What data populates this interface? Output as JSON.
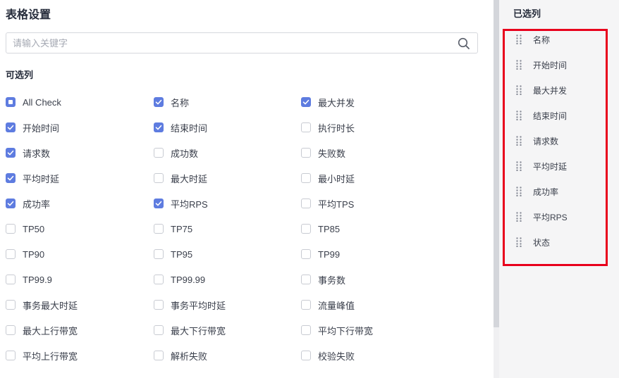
{
  "panel": {
    "title": "表格设置"
  },
  "search": {
    "placeholder": "请输入关键字"
  },
  "available": {
    "title": "可选列",
    "options": [
      {
        "label": "All Check",
        "state": "indeterminate"
      },
      {
        "label": "名称",
        "state": "checked"
      },
      {
        "label": "最大并发",
        "state": "checked"
      },
      {
        "label": "开始时间",
        "state": "checked"
      },
      {
        "label": "结束时间",
        "state": "checked"
      },
      {
        "label": "执行时长",
        "state": "unchecked"
      },
      {
        "label": "请求数",
        "state": "checked"
      },
      {
        "label": "成功数",
        "state": "unchecked"
      },
      {
        "label": "失败数",
        "state": "unchecked"
      },
      {
        "label": "平均时延",
        "state": "checked"
      },
      {
        "label": "最大时延",
        "state": "unchecked"
      },
      {
        "label": "最小时延",
        "state": "unchecked"
      },
      {
        "label": "成功率",
        "state": "checked"
      },
      {
        "label": "平均RPS",
        "state": "checked"
      },
      {
        "label": "平均TPS",
        "state": "unchecked"
      },
      {
        "label": "TP50",
        "state": "unchecked"
      },
      {
        "label": "TP75",
        "state": "unchecked"
      },
      {
        "label": "TP85",
        "state": "unchecked"
      },
      {
        "label": "TP90",
        "state": "unchecked"
      },
      {
        "label": "TP95",
        "state": "unchecked"
      },
      {
        "label": "TP99",
        "state": "unchecked"
      },
      {
        "label": "TP99.9",
        "state": "unchecked"
      },
      {
        "label": "TP99.99",
        "state": "unchecked"
      },
      {
        "label": "事务数",
        "state": "unchecked"
      },
      {
        "label": "事务最大时延",
        "state": "unchecked"
      },
      {
        "label": "事务平均时延",
        "state": "unchecked"
      },
      {
        "label": "流量峰值",
        "state": "unchecked"
      },
      {
        "label": "最大上行带宽",
        "state": "unchecked"
      },
      {
        "label": "最大下行带宽",
        "state": "unchecked"
      },
      {
        "label": "平均下行带宽",
        "state": "unchecked"
      },
      {
        "label": "平均上行带宽",
        "state": "unchecked"
      },
      {
        "label": "解析失败",
        "state": "unchecked"
      },
      {
        "label": "校验失败",
        "state": "unchecked"
      }
    ]
  },
  "selected": {
    "title": "已选列",
    "items": [
      "名称",
      "开始时间",
      "最大并发",
      "结束时间",
      "请求数",
      "平均时延",
      "成功率",
      "平均RPS",
      "状态"
    ]
  },
  "colors": {
    "accent": "#5e7ce0",
    "highlight": "#e8001c"
  }
}
